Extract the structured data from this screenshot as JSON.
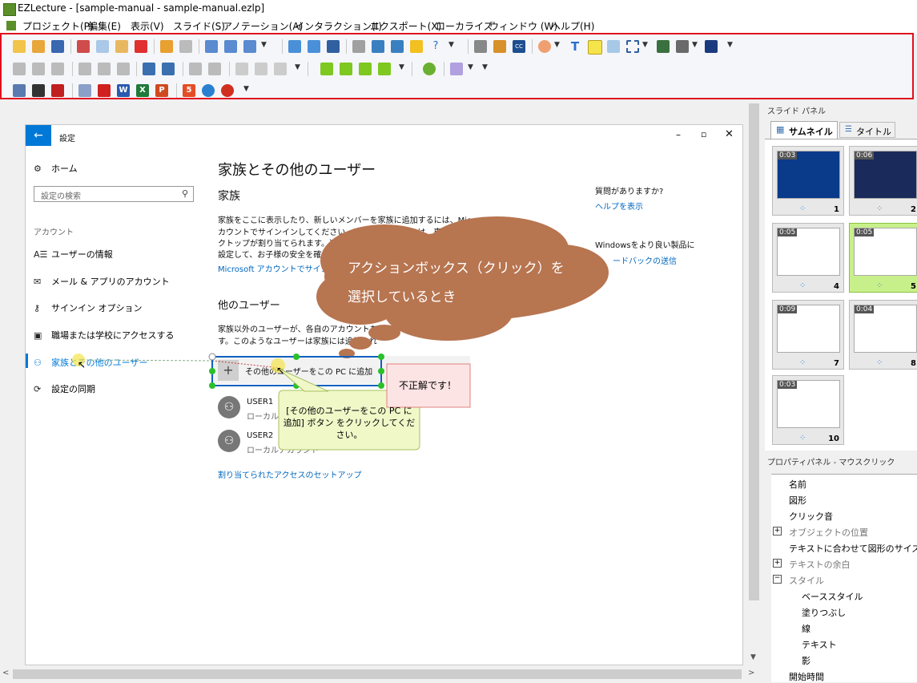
{
  "window": {
    "title": "EZLecture - [sample-manual - sample-manual.ezlp]"
  },
  "menu": [
    "プロジェクト(P)",
    "編集(E)",
    "表示(V)",
    "スライド(S)",
    "アノテーション(A)",
    "インタラクション(I)",
    "エクスポート(X)",
    "ローカライズ",
    "ウィンドウ (W)",
    "ヘルプ(H)"
  ],
  "settings": {
    "title": "設定",
    "home": "ホーム",
    "search_placeholder": "設定の検索",
    "section": "アカウント",
    "items": [
      "ユーザーの情報",
      "メール & アプリのアカウント",
      "サインイン オプション",
      "職場または学校にアクセスする",
      "家族とその他のユーザー",
      "設定の同期"
    ],
    "page_title": "家族とその他のユーザー",
    "family_heading": "家族",
    "family_line1": "家族をここに表示したり、新しいメンバーを家族に追加するには、Microsoft ア",
    "family_line2": "カウントでサインインしてください。家族のメンバーには、専用のサ",
    "family_line3": "クトップが割り当てられます。適切な Web",
    "family_line4": "設定して、お子様の安全を確保できま",
    "ms_signin_link": "Microsoft アカウントでサインイ",
    "question": "質問がありますか?",
    "help_link": "ヘルプを表示",
    "windows_better": "Windowsをより良い製品に",
    "feedback_link": "ードバックの送信",
    "other_heading": "他のユーザー",
    "other_line1": "家族以外のユーザーが、各自のアカウントを使",
    "other_line2": "す。このようなユーザーは家族には追加され",
    "add_button": "その他のユーザーをこの PC に追加",
    "users": [
      {
        "name": "USER1",
        "sub": "ローカルアカウント"
      },
      {
        "name": "USER2",
        "sub": "ローカルアカウント"
      }
    ],
    "assigned_access": "割り当てられたアクセスのセットアップ"
  },
  "annotations": {
    "cloud_line1": "アクションボックス（クリック）を",
    "cloud_line2": "選択しているとき",
    "incorrect": "不正解です！",
    "callout": "[その他のユーザーをこの PC に追加] ボタン をクリックしてください。"
  },
  "slide_panel": {
    "title": "スライド パネル",
    "tab_thumbnail": "サムネイル",
    "tab_title": "タイトル",
    "slides": [
      {
        "time": "0:03",
        "num": "1"
      },
      {
        "time": "0:06",
        "num": "2"
      },
      {
        "time": "0:05",
        "num": "4"
      },
      {
        "time": "0:05",
        "num": "5"
      },
      {
        "time": "0:09",
        "num": "7"
      },
      {
        "time": "0:04",
        "num": "8"
      },
      {
        "time": "0:03",
        "num": "10"
      }
    ]
  },
  "property_panel": {
    "title": "プロパティパネル - マウスクリック",
    "rows": [
      "名前",
      "図形",
      "クリック音",
      "オブジェクトの位置",
      "テキストに合わせて図形のサイズを調",
      "テキストの余白",
      "スタイル",
      "ベーススタイル",
      "塗りつぶし",
      "線",
      "テキスト",
      "影",
      "開始時間"
    ]
  },
  "colors": {
    "highlight_border": "#e0101f",
    "accent": "#0078d7",
    "cloud": "#b77550",
    "callout": "#f0f8c8",
    "incorrect_bg": "#fde4e4"
  }
}
